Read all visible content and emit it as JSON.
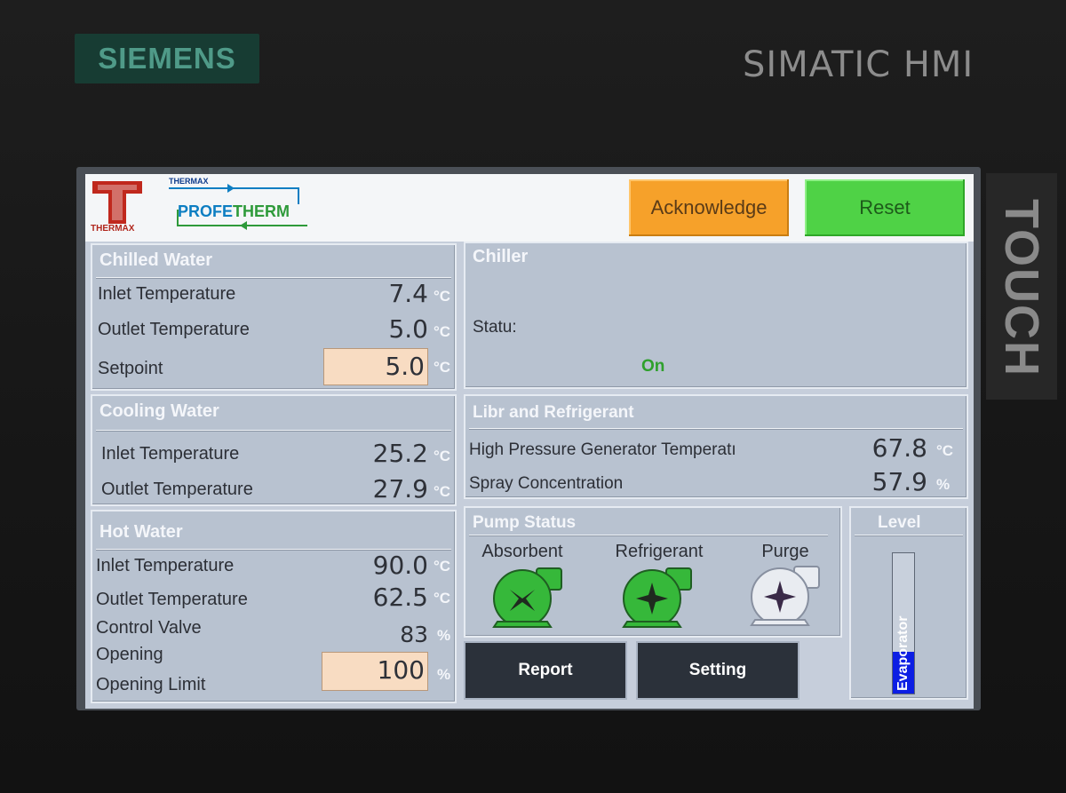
{
  "device": {
    "brand": "SIEMENS",
    "model": "SIMATIC HMI",
    "touch": "TOUCH"
  },
  "header": {
    "logo_caption": "THERMAX",
    "product_small": "THERMAX",
    "product_part1": "PROFE",
    "product_part2": "THERM",
    "acknowledge_label": "Acknowledge",
    "reset_label": "Reset"
  },
  "chilled_water": {
    "title": "Chilled Water",
    "inlet_label": "Inlet Temperature",
    "inlet_value": "7.4",
    "inlet_unit": "°C",
    "outlet_label": "Outlet Temperature",
    "outlet_value": "5.0",
    "outlet_unit": "°C",
    "setpoint_label": "Setpoint",
    "setpoint_value": "5.0",
    "setpoint_unit": "°C"
  },
  "chiller": {
    "title": "Chiller",
    "status_label": "Statu:",
    "status_value": "On"
  },
  "cooling_water": {
    "title": "Cooling Water",
    "inlet_label": "Inlet Temperature",
    "inlet_value": "25.2",
    "inlet_unit": "°C",
    "outlet_label": "Outlet Temperature",
    "outlet_value": "27.9",
    "outlet_unit": "°C"
  },
  "libr": {
    "title": "Libr and Refrigerant",
    "hpg_label": "High Pressure Generator Temperatı",
    "hpg_value": "67.8",
    "hpg_unit": "°C",
    "spray_label": "Spray Concentration",
    "spray_value": "57.9",
    "spray_unit": "%"
  },
  "hot_water": {
    "title": "Hot Water",
    "inlet_label": "Inlet Temperature",
    "inlet_value": "90.0",
    "inlet_unit": "°C",
    "outlet_label": "Outlet Temperature",
    "outlet_value": "62.5",
    "outlet_unit": "°C",
    "valve_label_1": "Control Valve",
    "valve_label_2": "Opening",
    "valve_value": "83",
    "valve_unit": "%",
    "limit_label": "Opening Limit",
    "limit_value": "100",
    "limit_unit": "%"
  },
  "pump_status": {
    "title": "Pump Status",
    "pumps": [
      {
        "label": "Absorbent",
        "state_color": "#36b83a"
      },
      {
        "label": "Refrigerant",
        "state_color": "#36b83a"
      },
      {
        "label": "Purge",
        "state_color": "#e9ecf1"
      }
    ]
  },
  "buttons": {
    "report_label": "Report",
    "setting_label": "Setting"
  },
  "level": {
    "title": "Level",
    "bar_label": "Evaporator",
    "fill_fraction": 0.3
  }
}
